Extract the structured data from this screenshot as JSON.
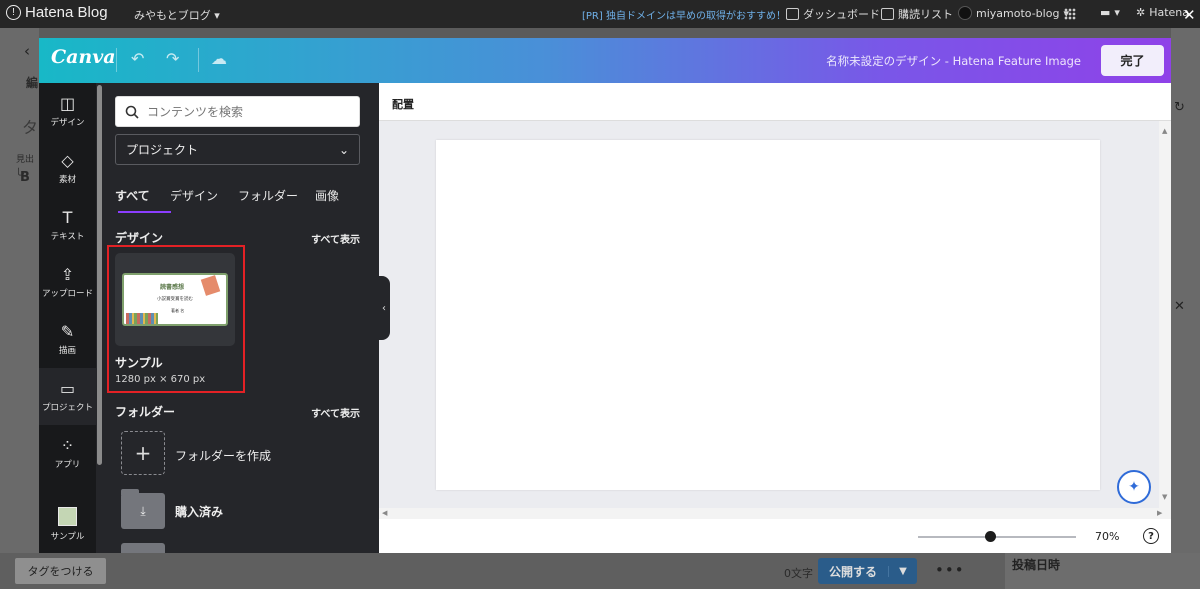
{
  "hatena_bar": {
    "logo": "Hatena Blog",
    "blog_name": "みやもとブログ",
    "promo": "[PR] 独自ドメインは早めの取得がおすすめ！",
    "dashboard": "ダッシュボード",
    "reading_list": "購読リスト",
    "user": "miyamoto-blog",
    "hatena": "Hatena"
  },
  "under_page": {
    "tag_button": "タグをつける",
    "char_count": "0文字",
    "publish_button": "公開する",
    "post_date": "投稿日時",
    "left_edit": "編",
    "left_tag": "タ",
    "left_heading": "見出し",
    "left_bold": "B"
  },
  "canva": {
    "logo": "Canva",
    "design_title": "名称未設定のデザイン - Hatena Feature Image",
    "done_button": "完了",
    "rail": {
      "design": "デザイン",
      "elements": "素材",
      "text": "テキスト",
      "upload": "アップロード",
      "draw": "描画",
      "projects": "プロジェクト",
      "apps": "アプリ",
      "sample": "サンプル"
    },
    "search_placeholder": "コンテンツを検索",
    "project_select": "プロジェクト",
    "tabs": [
      "すべて",
      "デザイン",
      "フォルダー",
      "画像"
    ],
    "designs_title": "デザイン",
    "see_all": "すべて表示",
    "design_item": {
      "name": "サンプル",
      "size": "1280 px × 670 px",
      "thumb_title": "読書感想",
      "thumb_line": "小説賞受賞を読む",
      "thumb_author": "著者 名"
    },
    "folders_title": "フォルダー",
    "create_folder": "フォルダーを作成",
    "purchased_folder": "購入済み",
    "canvas_header": "配置",
    "zoom": "70%",
    "zoom_level": 0.46,
    "help": "?"
  }
}
